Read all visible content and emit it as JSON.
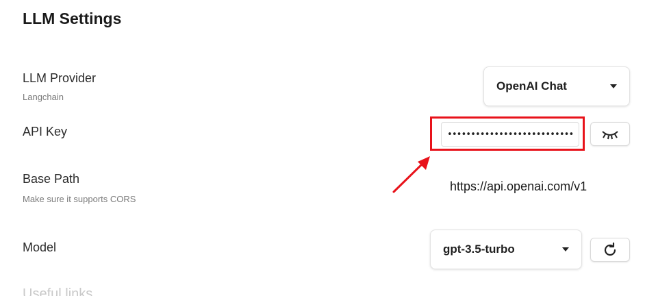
{
  "page": {
    "title": "LLM Settings"
  },
  "rows": {
    "provider": {
      "label": "LLM Provider",
      "sublabel": "Langchain",
      "selected": "OpenAI Chat"
    },
    "api_key": {
      "label": "API Key",
      "value": "•••••••••••••••••••••••••••••",
      "toggle_icon": "eye-closed-icon"
    },
    "base_path": {
      "label": "Base Path",
      "sublabel": "Make sure it supports CORS",
      "value": "https://api.openai.com/v1"
    },
    "model": {
      "label": "Model",
      "selected": "gpt-3.5-turbo",
      "refresh_icon": "refresh-icon"
    }
  },
  "next_section": {
    "title": "Useful links"
  },
  "annotation": {
    "highlight_color": "#e8121a",
    "arrow_icon": "red-arrow-icon"
  }
}
